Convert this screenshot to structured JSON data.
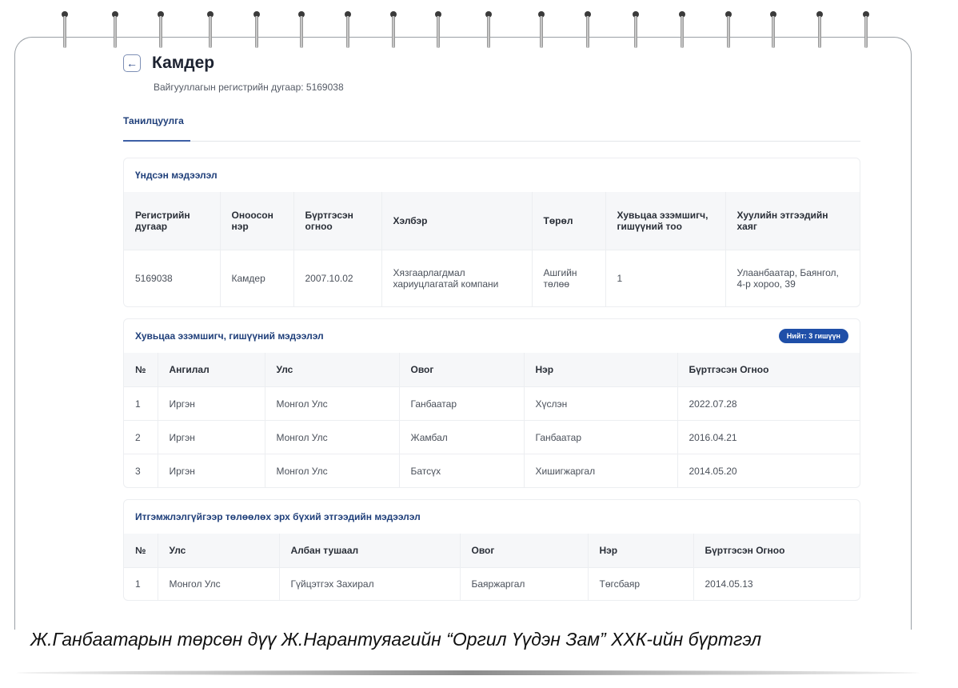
{
  "header": {
    "back_icon": "arrow-left-icon",
    "title": "Камдер",
    "subtitle": "Вайгууллагын регистрийн дугаар: 5169038"
  },
  "tabs": [
    {
      "label": "Танилцуулга",
      "active": true
    }
  ],
  "basic_info": {
    "title": "Үндсэн мэдээлэл",
    "columns": [
      "Регистрийн дугаар",
      "Оноосон нэр",
      "Бүртгэсэн огноо",
      "Хэлбэр",
      "Төрөл",
      "Хувьцаа эзэмшигч, гишүүний тоо",
      "Хуулийн этгээдийн хаяг"
    ],
    "row": [
      "5169038",
      "Камдер",
      "2007.10.02",
      "Хязгаарлагдмал хариуцлагатай компани",
      "Ашгийн төлөө",
      "1",
      "Улаанбаатар, Баянгол, 4-р хороо, 39"
    ]
  },
  "shareholders": {
    "title": "Хувьцаа эзэмшигч, гишүүний мэдээлэл",
    "badge": "Нийт: 3 гишүүн",
    "columns": [
      "№",
      "Ангилал",
      "Улс",
      "Овог",
      "Нэр",
      "Бүртгэсэн Огноо"
    ],
    "rows": [
      [
        "1",
        "Иргэн",
        "Монгол Улс",
        "Ганбаатар",
        "Хүслэн",
        "2022.07.28"
      ],
      [
        "2",
        "Иргэн",
        "Монгол Улс",
        "Жамбал",
        "Ганбаатар",
        "2016.04.21"
      ],
      [
        "3",
        "Иргэн",
        "Монгол Улс",
        "Батсүх",
        "Хишигжаргал",
        "2014.05.20"
      ]
    ]
  },
  "representatives": {
    "title": "Итгэмжлэлгүйгээр төлөөлөх эрх бүхий этгээдийн мэдээлэл",
    "columns": [
      "№",
      "Улс",
      "Албан тушаал",
      "Овог",
      "Нэр",
      "Бүртгэсэн Огноо"
    ],
    "rows": [
      [
        "1",
        "Монгол Улс",
        "Гүйцэтгэх Захирал",
        "Баяржаргал",
        "Төгсбаяр",
        "2014.05.13"
      ]
    ]
  },
  "caption": "Ж.Ганбаатарын төрсөн дүү Ж.Нарантуяагийн “Оргил Үүдэн Зам” ХХК-ийн бүртгэл",
  "colors": {
    "accent": "#1f4fa8",
    "title": "#1f3f7a"
  }
}
